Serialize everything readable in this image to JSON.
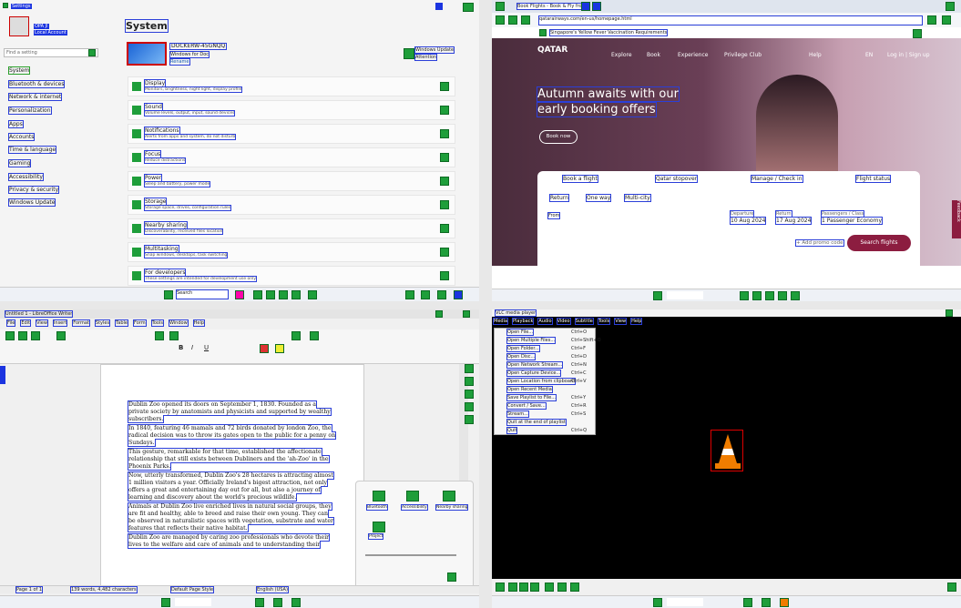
{
  "settings": {
    "title_tag": "Settings",
    "user_name": "OPA Jl",
    "user_sub": "Local Account",
    "search_placeholder": "Find a setting",
    "nav": [
      "System",
      "Bluetooth & devices",
      "Network & internet",
      "Personalization",
      "Apps",
      "Accounts",
      "Time & language",
      "Gaming",
      "Accessibility",
      "Privacy & security",
      "Windows Update"
    ],
    "heading": "System",
    "device_name": "DOCKERW-45GNQQ",
    "device_os": "Windows for Doc",
    "rename": "Rename",
    "update_title": "Windows Update",
    "update_sub": "Attention",
    "rows": [
      {
        "t": "Display",
        "s": "Monitors, brightness, night light, display profile"
      },
      {
        "t": "Sound",
        "s": "Volume levels, output, input, sound devices"
      },
      {
        "t": "Notifications",
        "s": "Alerts from apps and system, do not disturb"
      },
      {
        "t": "Focus",
        "s": "Reduce distractions"
      },
      {
        "t": "Power",
        "s": "Sleep and battery, power mode"
      },
      {
        "t": "Storage",
        "s": "Storage space, drives, configuration rules"
      },
      {
        "t": "Nearby sharing",
        "s": "Discoverability, received files location"
      },
      {
        "t": "Multitasking",
        "s": "Snap windows, desktops, task switching"
      },
      {
        "t": "For developers",
        "s": "These settings are intended for development use only"
      }
    ],
    "taskbar_search": "Search"
  },
  "qatar": {
    "tab_label": "Book Flights - Book & Fly from",
    "url": "qatarairways.com/en-us/homepage.html",
    "notice": "Singapore's Yellow Fever Vaccination Requirements",
    "logo": "QATAR",
    "nav": [
      "Explore",
      "Book",
      "Experience",
      "Privilege Club"
    ],
    "nav_right": [
      "Help",
      "EN",
      "Log in | Sign up"
    ],
    "headline_1": "Autumn awaits with our",
    "headline_2": "early booking offers",
    "cta": "Book now",
    "tabs": [
      "Book a flight",
      "Qatar stopover",
      "Manage / Check in",
      "Flight status"
    ],
    "trip_types": [
      "Return",
      "One way",
      "Multi-city"
    ],
    "from_label": "From",
    "departure_label": "Departure",
    "departure_value": "10 Aug 2024",
    "return_label": "Return",
    "return_value": "17 Aug 2024",
    "passengers_label": "Passengers / Class",
    "passengers_value": "1 Passenger Economy",
    "promo": "+ Add promo code",
    "search_button": "Search flights",
    "feedback": "Feedback"
  },
  "writer": {
    "title": "Untitled 1 - LibreOffice Writer",
    "menu": [
      "File",
      "Edit",
      "View",
      "Insert",
      "Format",
      "Styles",
      "Table",
      "Form",
      "Tools",
      "Window",
      "Help"
    ],
    "paragraphs": [
      "Dublin Zoo opened its doors on September 1, 1830. Founded as a private society by anatomists and physicists and supported by wealthy subscribers.",
      "In 1840, featuring 46 mamals and 72 birds donated by london Zoo, the radical decision was to throw its gates open to the public for a penny on Sundays.",
      "This gesture, remarkable for that time, established the affectionate relationship that still exists between Dubliners and the 'ah-Zoo' in the Phoenix Parks.",
      "Now, utterly transformed, Dublin Zoo's 28 hectares is attracting almost 1 million visitors a year. Officially Ireland's bigest attraction, not only offers a great and entertaining day out for all, but also a journey of learning and discovery about the world's precious wildlife.",
      "Animals at Dublin Zoo live enriched lives in natural social groups, they are fit and healthy, able to breed and raise their own young. They can be observed in naturalistic spaces with vegetation, substrate and water features that reflects their native habitat.",
      "Dublin Zoo are managed by caring zoo professionals who devote their lives to the welfare and care of animals and to understanding their"
    ],
    "status_page": "Page 1 of 1",
    "status_words": "139 words, 4,482 characters",
    "status_style": "Default Page Style",
    "status_lang": "English (USA)",
    "quick_panel": [
      "Bluetooth",
      "Accessibility",
      "Nearby sharing",
      "Project"
    ]
  },
  "vlc": {
    "title": "VLC media player",
    "menu": [
      "Media",
      "Playback",
      "Audio",
      "Video",
      "Subtitle",
      "Tools",
      "View",
      "Help"
    ],
    "items": [
      "Open File...",
      "Open Multiple Files...",
      "Open Folder...",
      "Open Disc...",
      "Open Network Stream...",
      "Open Capture Device...",
      "Open Location from clipboard",
      "Open Recent Media",
      "Save Playlist to File...",
      "Convert / Save...",
      "Stream...",
      "Quit at the end of playlist",
      "Quit"
    ],
    "shortcuts": [
      "Ctrl+O",
      "Ctrl+Shift+O",
      "Ctrl+F",
      "Ctrl+D",
      "Ctrl+N",
      "Ctrl+C",
      "Ctrl+V",
      "",
      "Ctrl+Y",
      "Ctrl+R",
      "Ctrl+S",
      "",
      "Ctrl+Q"
    ]
  }
}
